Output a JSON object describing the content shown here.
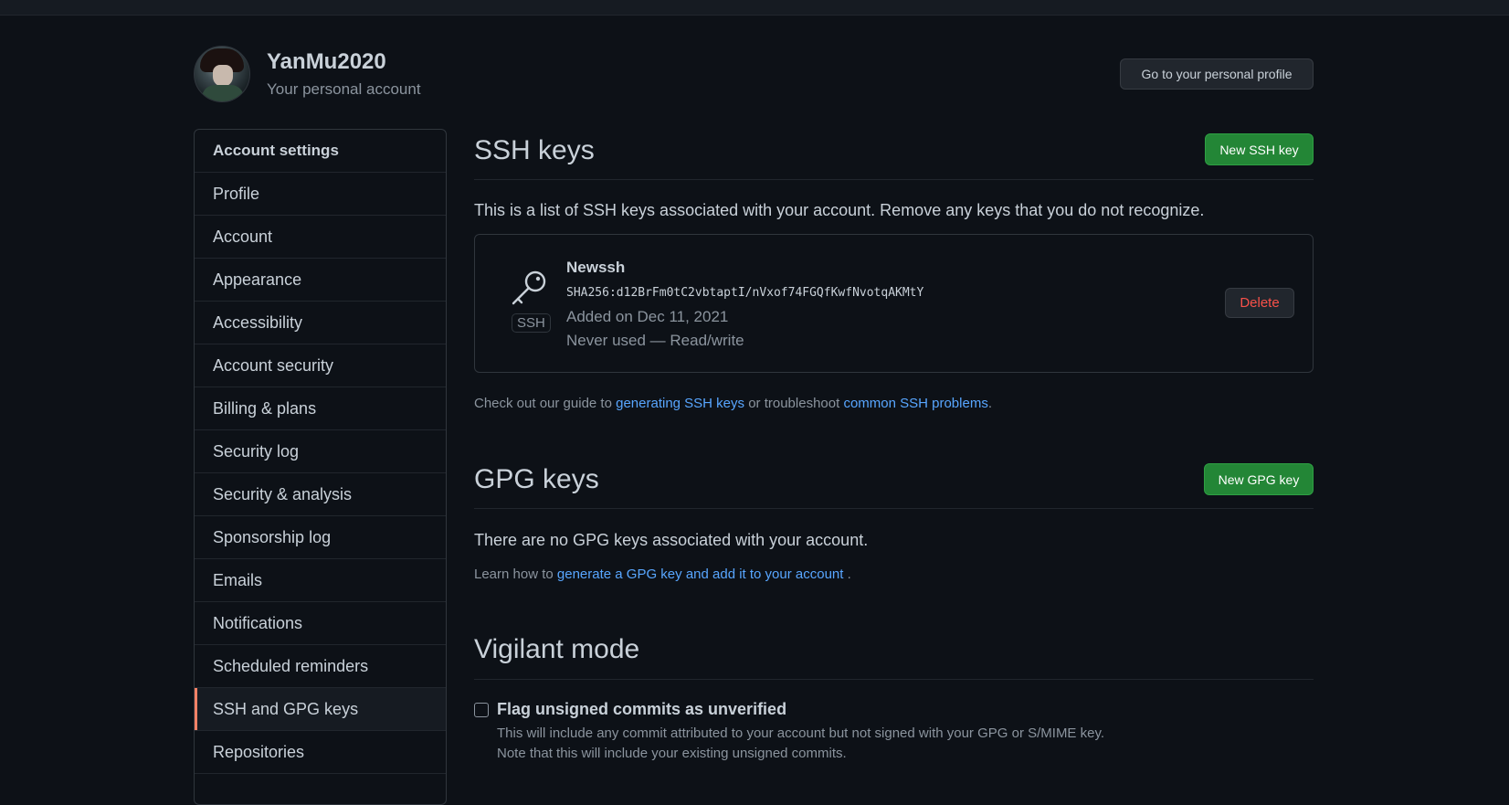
{
  "header": {
    "username": "YanMu2020",
    "subtitle": "Your personal account",
    "profile_button": "Go to your personal profile"
  },
  "sidebar": {
    "heading": "Account settings",
    "items": [
      {
        "label": "Profile"
      },
      {
        "label": "Account"
      },
      {
        "label": "Appearance"
      },
      {
        "label": "Accessibility"
      },
      {
        "label": "Account security"
      },
      {
        "label": "Billing & plans"
      },
      {
        "label": "Security log"
      },
      {
        "label": "Security & analysis"
      },
      {
        "label": "Sponsorship log"
      },
      {
        "label": "Emails"
      },
      {
        "label": "Notifications"
      },
      {
        "label": "Scheduled reminders"
      },
      {
        "label": "SSH and GPG keys",
        "selected": true
      },
      {
        "label": "Repositories"
      }
    ]
  },
  "ssh": {
    "title": "SSH keys",
    "new_button": "New SSH key",
    "description": "This is a list of SSH keys associated with your account. Remove any keys that you do not recognize.",
    "key": {
      "badge": "SSH",
      "name": "Newssh",
      "fingerprint": "SHA256:d12BrFm0tC2vbtaptI/nVxof74FGQfKwfNvotqAKMtY",
      "added": "Added on Dec 11, 2021",
      "usage": "Never used — Read/write",
      "delete_button": "Delete"
    },
    "guide": {
      "prefix": "Check out our guide to ",
      "link1": "generating SSH keys",
      "middle": " or troubleshoot ",
      "link2": "common SSH problems",
      "suffix": "."
    }
  },
  "gpg": {
    "title": "GPG keys",
    "new_button": "New GPG key",
    "empty_text": "There are no GPG keys associated with your account.",
    "learn_prefix": "Learn how to ",
    "learn_link": "generate a GPG key and add it to your account",
    "learn_suffix": " ."
  },
  "vigilant": {
    "title": "Vigilant mode",
    "checkbox_label": "Flag unsigned commits as unverified",
    "checked": false,
    "note1": "This will include any commit attributed to your account but not signed with your GPG or S/MIME key.",
    "note2": "Note that this will include your existing unsigned commits."
  },
  "icons": {
    "key": "key-icon",
    "avatar": "avatar"
  },
  "colors": {
    "background": "#0d1117",
    "link": "#58a6ff",
    "primary_button": "#238636",
    "danger": "#f85149",
    "selected_accent": "#f78166"
  }
}
